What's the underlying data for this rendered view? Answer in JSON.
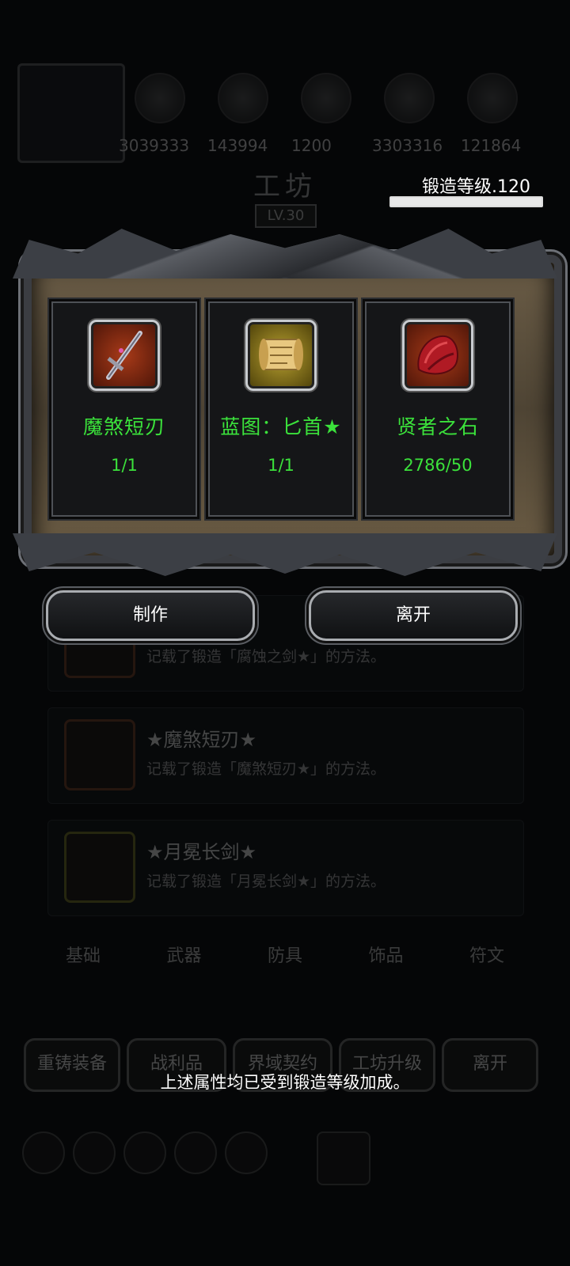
{
  "background": {
    "resources": [
      "3039333",
      "143994",
      "1200",
      "3303316",
      "121864"
    ],
    "title": "工坊",
    "level": "LV.30",
    "list_items": [
      {
        "title": "",
        "desc": "记载了锻造「腐蚀之剑★」的方法。"
      },
      {
        "title": "★魔煞短刃★",
        "desc": "记载了锻造「魔煞短刃★」的方法。"
      },
      {
        "title": "★月冕长剑★",
        "desc": "记载了锻造「月冕长剑★」的方法。"
      }
    ],
    "tabs": [
      "基础",
      "武器",
      "防具",
      "饰品",
      "符文"
    ],
    "buttons": [
      "重铸装备",
      "战利品",
      "界域契约",
      "工坊升级",
      "离开"
    ]
  },
  "forge": {
    "level_label": "锻造等级.120",
    "level_progress": 1.0
  },
  "materials": [
    {
      "name": "魔煞短刃",
      "count": "1/1",
      "icon": "dagger-icon",
      "bg": "#7a2410"
    },
    {
      "name": "蓝图：匕首★",
      "count": "1/1",
      "icon": "scroll-icon",
      "bg": "#8a7a20"
    },
    {
      "name": "贤者之石",
      "count": "2786/50",
      "icon": "red-stone-icon",
      "bg": "#7a2410"
    }
  ],
  "actions": {
    "craft": "制作",
    "leave": "离开"
  },
  "notice": "上述属性均已受到锻造等级加成。",
  "colors": {
    "material_text": "#3be23b",
    "frame": "#3b3d42"
  }
}
